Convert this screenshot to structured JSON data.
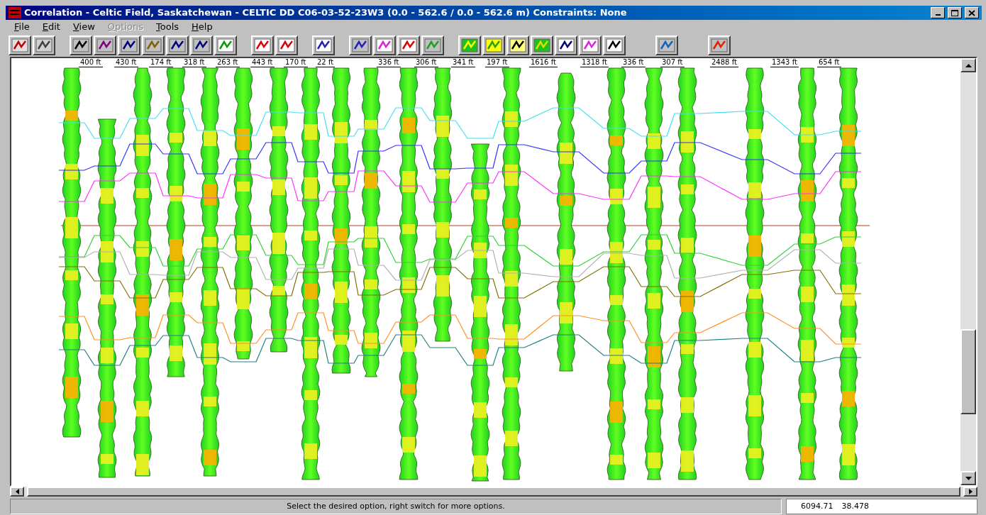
{
  "window": {
    "title": "Correlation - Celtic Field, Saskatchewan - CELTIC DD C06-03-52-23W3 (0.0 - 562.6 / 0.0 - 562.6 m) Constraints:  None"
  },
  "menu": [
    {
      "label": "File",
      "disabled": false
    },
    {
      "label": "Edit",
      "disabled": false
    },
    {
      "label": "View",
      "disabled": false
    },
    {
      "label": "Options",
      "disabled": true
    },
    {
      "label": "Tools",
      "disabled": false
    },
    {
      "label": "Help",
      "disabled": false
    }
  ],
  "distance_labels": [
    "400 ft",
    "430 ft",
    "174 ft",
    "318 ft",
    "263 ft",
    "443 ft",
    "170 ft",
    "22 ft",
    "336 ft",
    "306 ft",
    "341 ft",
    "197 ft",
    "1616 ft",
    "1318 ft",
    "336 ft",
    "307 ft",
    "2488 ft",
    "1343 ft",
    "654 ft"
  ],
  "status_bar": {
    "message": "Select the desired option, right switch for more options.",
    "x_reading": "6094.71",
    "y_reading": "38.478"
  }
}
